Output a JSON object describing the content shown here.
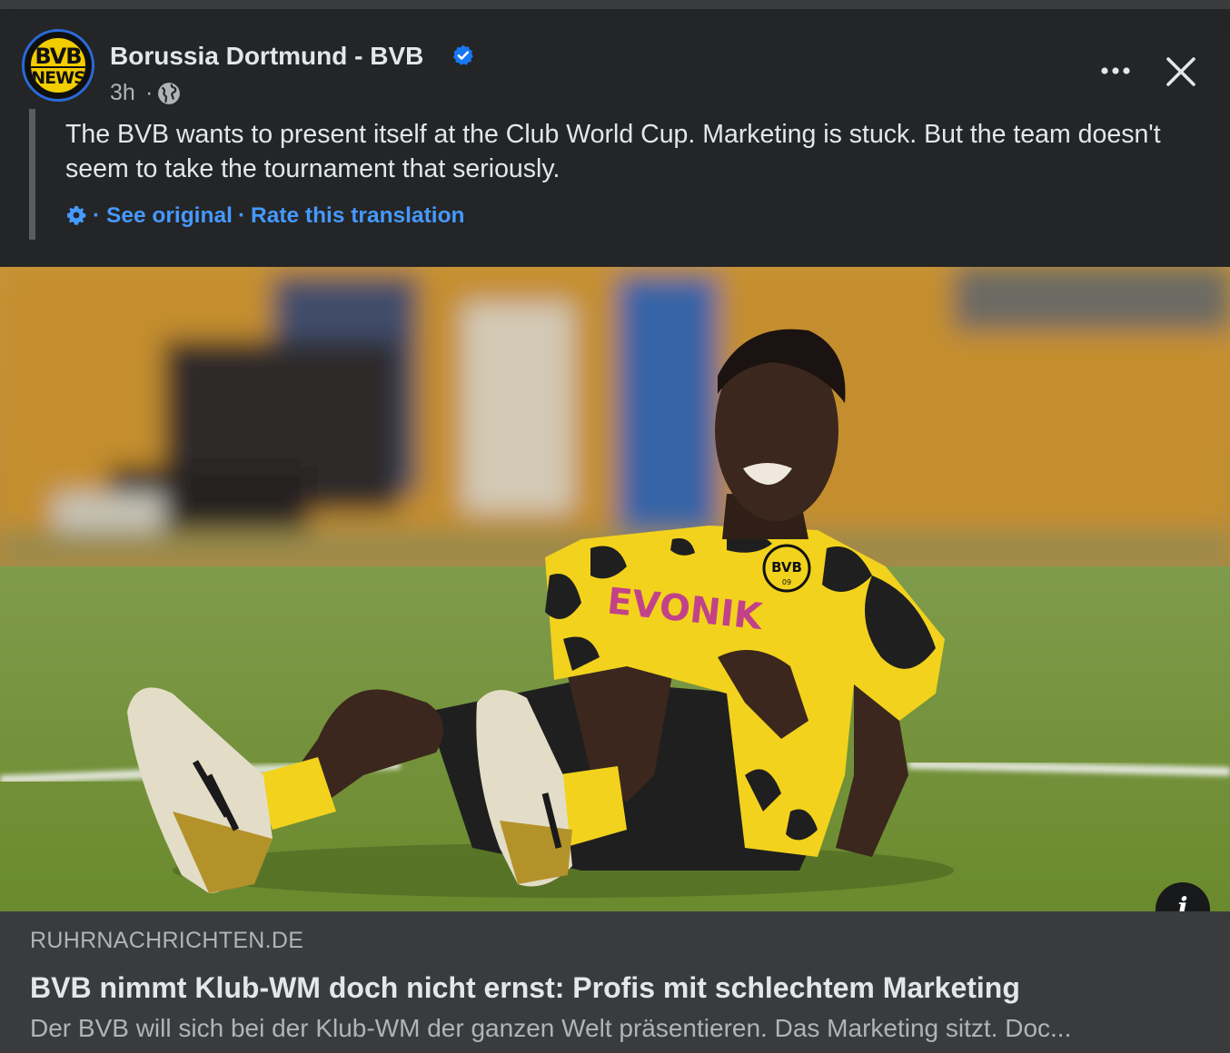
{
  "post": {
    "page_name": "Borussia Dortmund - BVB",
    "time": "3h",
    "dot": "·",
    "avatar": {
      "line1": "BVB",
      "line2": "NEWS"
    },
    "text": "The BVB wants to present itself at the Club World Cup. Marketing is stuck. But the team doesn't seem to take the tournament that seriously.",
    "translation": {
      "separator": "·",
      "see_original": "See original",
      "rate": "Rate this translation"
    }
  },
  "photo": {
    "sponsor": "EVONIK",
    "crest": "BVB",
    "crest_year": "09"
  },
  "info": {
    "glyph": "i"
  },
  "link": {
    "domain": "RUHRNACHRICHTEN.DE",
    "title": "BVB nimmt Klub-WM doch nicht ernst: Profis mit schlechtem Marketing",
    "description": "Der BVB will sich bei der Klub-WM der ganzen Welt präsentieren. Das Marketing sitzt. Doc..."
  },
  "colors": {
    "background": "#242526",
    "link_blue": "#4599ff",
    "verified_blue": "#1877f2",
    "jersey_yellow": "#f2d21d"
  },
  "icons": [
    "verified-badge-icon",
    "globe-icon",
    "more-options-icon",
    "close-icon",
    "gear-icon",
    "info-icon"
  ]
}
